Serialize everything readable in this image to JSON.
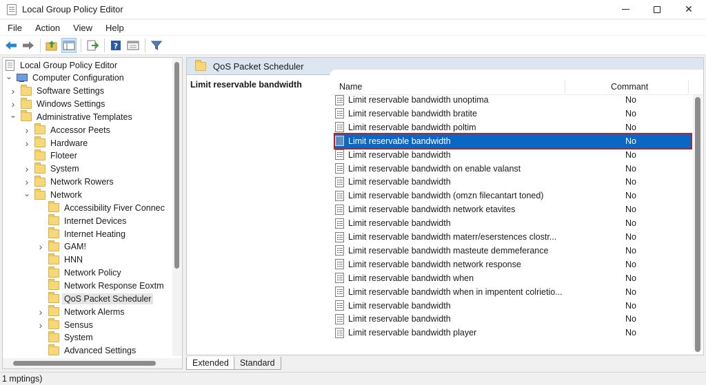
{
  "window": {
    "title": "Local Group Policy Editor"
  },
  "menu": [
    "File",
    "Action",
    "View",
    "Help"
  ],
  "toolbar": {
    "buttons": [
      "back-arrow-icon",
      "forward-arrow-icon",
      "up-folder-icon",
      "show-hide-tree-icon",
      "export-list-icon",
      "help-icon",
      "properties-icon",
      "filter-icon"
    ]
  },
  "tree": {
    "items": [
      {
        "label": "Local Group Policy Editor",
        "icon": "policy-doc-icon",
        "level": 0,
        "chevron": ""
      },
      {
        "label": "Computer Configuration",
        "icon": "computer-icon",
        "level": 0,
        "chevron": "expanded"
      },
      {
        "label": "Software Settings",
        "icon": "folder-icon",
        "level": 1,
        "chevron": "collapsed"
      },
      {
        "label": "Windows Settings",
        "icon": "folder-icon",
        "level": 1,
        "chevron": "collapsed"
      },
      {
        "label": "Administrative Templates",
        "icon": "folder-icon",
        "level": 1,
        "chevron": "expanded"
      },
      {
        "label": "Accessor Peets",
        "icon": "folder-icon",
        "level": 2,
        "chevron": "collapsed"
      },
      {
        "label": "Hardware",
        "icon": "folder-icon",
        "level": 2,
        "chevron": "collapsed"
      },
      {
        "label": "Floteer",
        "icon": "folder-icon",
        "level": 2,
        "chevron": ""
      },
      {
        "label": "System",
        "icon": "folder-icon",
        "level": 2,
        "chevron": "collapsed"
      },
      {
        "label": "Network Rowers",
        "icon": "folder-icon",
        "level": 2,
        "chevron": "collapsed"
      },
      {
        "label": "Network",
        "icon": "folder-icon",
        "level": 2,
        "chevron": "expanded"
      },
      {
        "label": "Accessibility Fiver Connec",
        "icon": "folder-icon",
        "level": 3,
        "chevron": ""
      },
      {
        "label": "Internet Devices",
        "icon": "folder-icon",
        "level": 3,
        "chevron": ""
      },
      {
        "label": "Internet Heating",
        "icon": "folder-icon",
        "level": 3,
        "chevron": ""
      },
      {
        "label": "GAM!",
        "icon": "folder-icon",
        "level": 3,
        "chevron": "collapsed"
      },
      {
        "label": "HNN",
        "icon": "folder-icon",
        "level": 3,
        "chevron": ""
      },
      {
        "label": "Network Policy",
        "icon": "folder-icon",
        "level": 3,
        "chevron": ""
      },
      {
        "label": "Network Response Eoxtm",
        "icon": "folder-icon",
        "level": 3,
        "chevron": ""
      },
      {
        "label": "QoS Packet Scheduler",
        "icon": "folder-icon",
        "level": 3,
        "chevron": "",
        "selected": true
      },
      {
        "label": "Network Alerms",
        "icon": "folder-icon",
        "level": 3,
        "chevron": "collapsed"
      },
      {
        "label": "Sensus",
        "icon": "folder-icon",
        "level": 3,
        "chevron": "collapsed"
      },
      {
        "label": "System",
        "icon": "folder-icon",
        "level": 3,
        "chevron": ""
      },
      {
        "label": "Advanced Settings",
        "icon": "folder-icon",
        "level": 3,
        "chevron": ""
      }
    ]
  },
  "right": {
    "header": "QoS Packet Scheduler",
    "description": "Limit reservable bandwidth",
    "columns": {
      "name": "Name",
      "comment": "Commant"
    },
    "rows": [
      {
        "name": "Limit reservable bandwidth unoptima",
        "comment": "No"
      },
      {
        "name": "Limit reservable bandwidth bratite",
        "comment": "No"
      },
      {
        "name": "Limit reservable bandwidth poltim",
        "comment": "No"
      },
      {
        "name": "Limit reservable bandwidth",
        "comment": "No",
        "selected": true
      },
      {
        "name": "Limit reservable bandwidth",
        "comment": "No"
      },
      {
        "name": "Limit reservable bandwidth on enable valanst",
        "comment": "No"
      },
      {
        "name": "Limit reservable bandwidth",
        "comment": "No"
      },
      {
        "name": "Limit reservable bandwidth (omzn filecantart toned)",
        "comment": "No"
      },
      {
        "name": "Limit reservable bandwidth network etavites",
        "comment": "No"
      },
      {
        "name": "Limit reservable bandwidth",
        "comment": "No"
      },
      {
        "name": "Limit reservable bandwidth materr/eserstences clostr...",
        "comment": "No"
      },
      {
        "name": "Limit reservable bandwidth masteute demmeferance",
        "comment": "No"
      },
      {
        "name": "Limit reservable bandwidth network response",
        "comment": "No"
      },
      {
        "name": "Limit reservable bandwidth when",
        "comment": "No"
      },
      {
        "name": "Limit reservable bandwidth when in impentent colrietio...",
        "comment": "No"
      },
      {
        "name": "Limit reservable bandwidth",
        "comment": "No"
      },
      {
        "name": "Limit reservable bandwidth",
        "comment": "No"
      },
      {
        "name": "Limit reservable bandwidth player",
        "comment": "No"
      }
    ]
  },
  "tabs": [
    "Extended",
    "Standard"
  ],
  "status": "1 mptings)"
}
